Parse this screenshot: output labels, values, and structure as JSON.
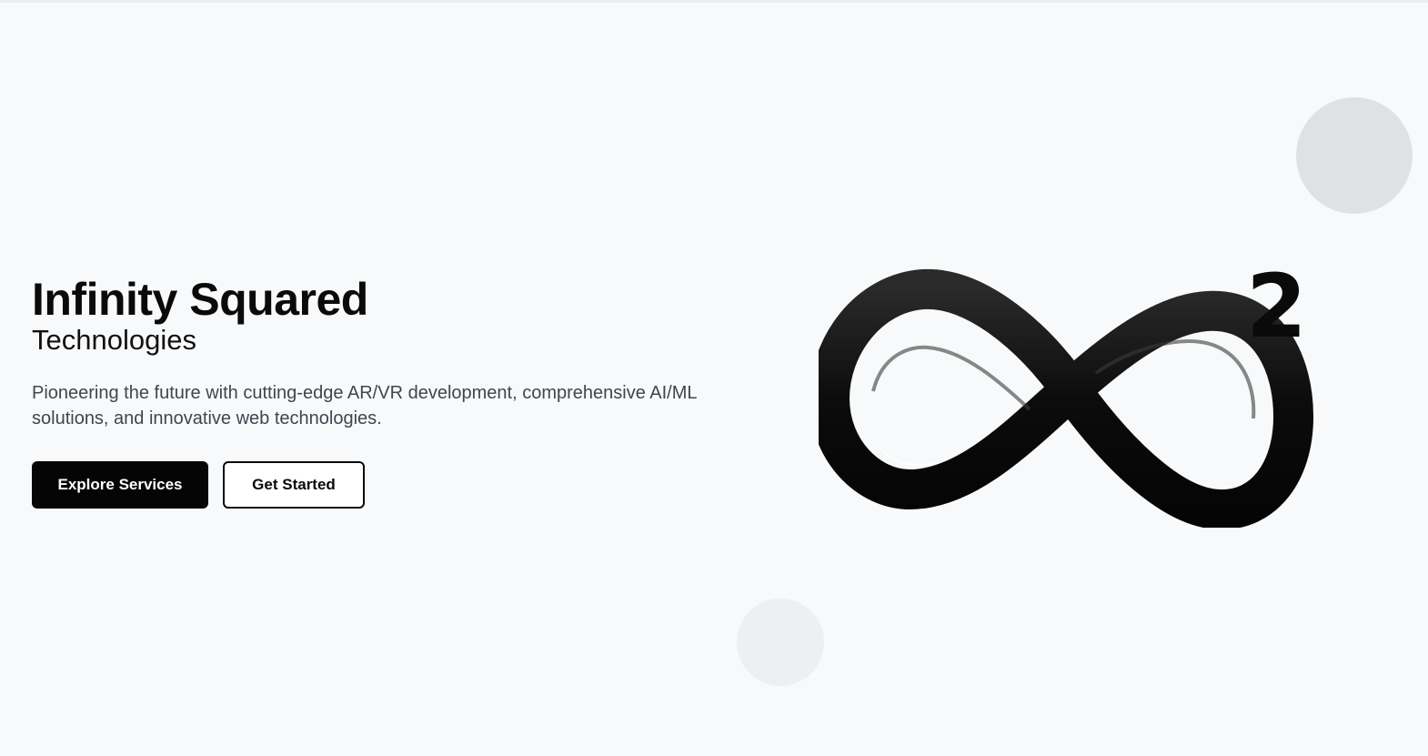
{
  "hero": {
    "title": "Infinity Squared",
    "subtitle": "Technologies",
    "description": "Pioneering the future with cutting-edge AR/VR development, comprehensive AI/ML solutions, and innovative web technologies.",
    "primary_button": "Explore Services",
    "secondary_button": "Get Started"
  },
  "logo": {
    "icon": "infinity-squared-logo",
    "superscript": "2"
  },
  "colors": {
    "background": "#f8f9fa",
    "primary": "#050505",
    "text_muted": "#3f4650",
    "circle_light": "#dfe2e5",
    "circle_lighter": "#eeeff0"
  }
}
